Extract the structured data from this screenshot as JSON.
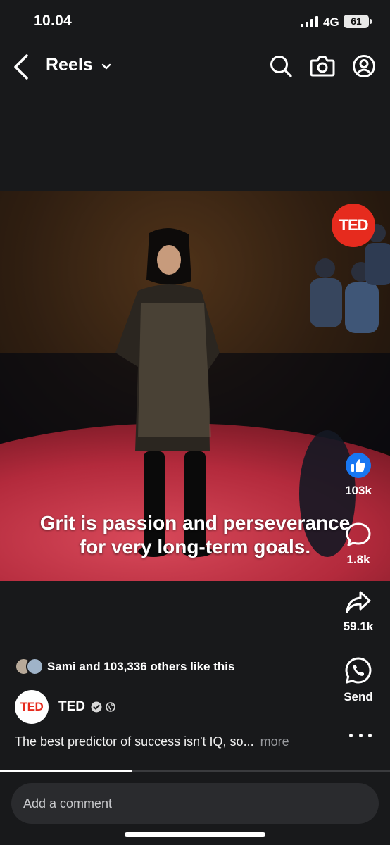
{
  "status_bar": {
    "time": "10.04",
    "network": "4G",
    "battery": "61"
  },
  "nav": {
    "title": "Reels"
  },
  "video": {
    "badge": "TED",
    "caption_line1": "Grit is passion and perseverance",
    "caption_line2": "for very long-term goals."
  },
  "actions": {
    "like_count": "103k",
    "comment_count": "1.8k",
    "share_count": "59.1k",
    "send_label": "Send"
  },
  "social": {
    "likes_text": "Sami and 103,336 others like this"
  },
  "author": {
    "avatar_text": "TED",
    "name": "TED"
  },
  "description": {
    "text": "The best predictor of success isn't IQ, so...",
    "more": "more"
  },
  "progress": {
    "fraction": 0.34
  },
  "comment": {
    "placeholder": "Add a comment"
  },
  "colors": {
    "background": "#18191b",
    "like_blue": "#1877f2",
    "ted_red": "#e62b1e"
  }
}
